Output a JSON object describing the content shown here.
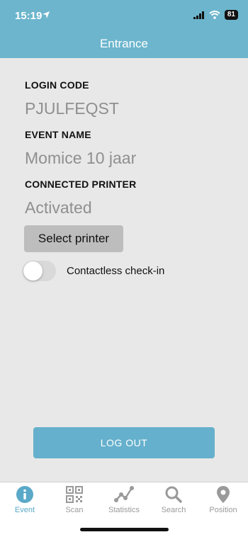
{
  "status_bar": {
    "time": "15:19",
    "battery": "81"
  },
  "header": {
    "title": "Entrance"
  },
  "fields": [
    {
      "label": "LOGIN CODE",
      "value": "PJULFEQST"
    },
    {
      "label": "EVENT NAME",
      "value": "Momice 10 jaar"
    },
    {
      "label": "CONNECTED PRINTER",
      "value": "Activated"
    }
  ],
  "select_printer_label": "Select printer",
  "contactless": {
    "label": "Contactless check-in",
    "enabled": false
  },
  "logout_label": "LOG OUT",
  "tabs": [
    {
      "label": "Event",
      "icon": "info-icon",
      "active": true
    },
    {
      "label": "Scan",
      "icon": "qr-icon",
      "active": false
    },
    {
      "label": "Statistics",
      "icon": "statistics-icon",
      "active": false
    },
    {
      "label": "Search",
      "icon": "search-icon",
      "active": false
    },
    {
      "label": "Position",
      "icon": "location-pin-icon",
      "active": false
    }
  ],
  "colors": {
    "header": "#6cb5cd",
    "accent": "#5aa9c8",
    "button_gray": "#bdbdbd"
  }
}
